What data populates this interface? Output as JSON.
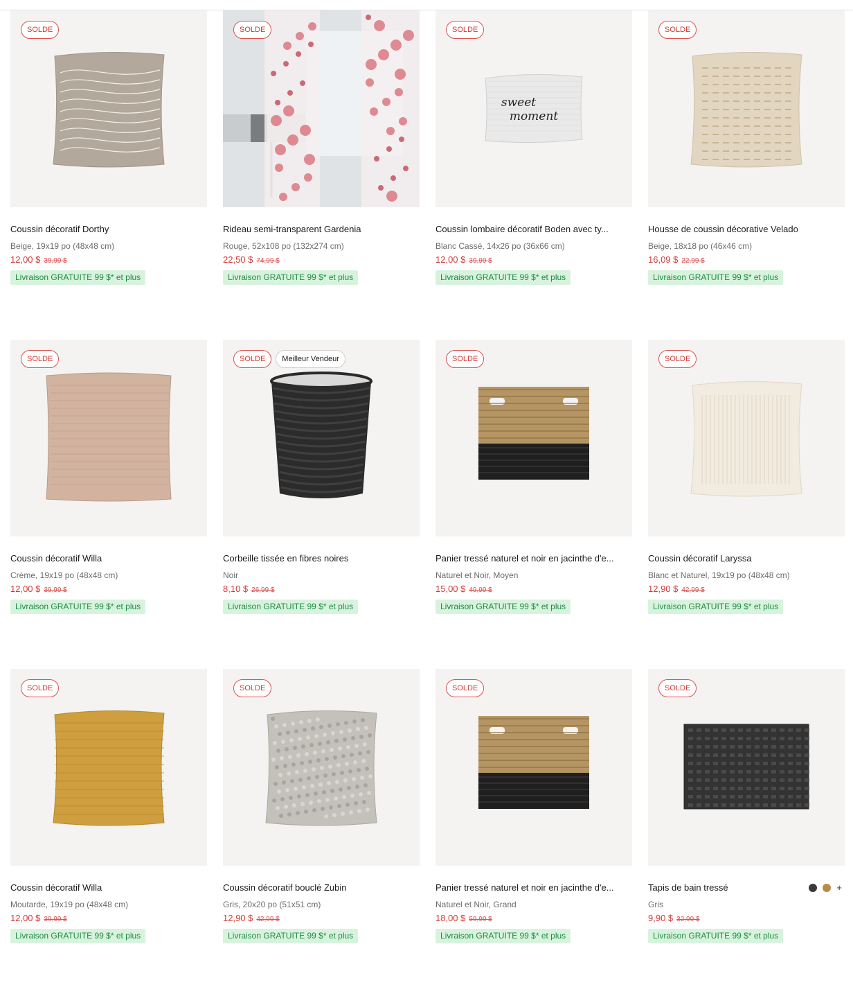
{
  "colors": {
    "sale": "#d33b35",
    "shipping_bg": "#d8f3dd",
    "shipping_text": "#1f8b44",
    "card_bg": "#f4f3f2"
  },
  "products": [
    {
      "badges": [
        "SOLDE"
      ],
      "name": "Coussin décoratif Dorthy",
      "variant": "Beige, 19x19 po (48x48 cm)",
      "price": "12,00 $",
      "was": "39,99 $",
      "shipping": "Livraison GRATUITE 99 $* et plus",
      "image": "pillow-beige-wave"
    },
    {
      "badges": [
        "SOLDE"
      ],
      "name": "Rideau semi-transparent Gardenia",
      "variant": "Rouge, 52x108 po (132x274 cm)",
      "price": "22,50 $",
      "was": "74,99 $",
      "shipping": "Livraison GRATUITE 99 $* et plus",
      "image": "curtain-red-floral"
    },
    {
      "badges": [
        "SOLDE"
      ],
      "name": "Coussin lombaire décoratif Boden avec ty...",
      "variant": "Blanc Cassé, 14x26 po (36x66 cm)",
      "price": "12,00 $",
      "was": "39,99 $",
      "shipping": "Livraison GRATUITE 99 $* et plus",
      "image": "lumbar-pillow-sweet-moment",
      "pillow_text": [
        "sweet",
        "moment"
      ]
    },
    {
      "badges": [
        "SOLDE"
      ],
      "name": "Housse de coussin décorative Velado",
      "variant": "Beige, 18x18 po (46x46 cm)",
      "price": "16,09 $",
      "was": "22,99 $",
      "shipping": "Livraison GRATUITE 99 $* et plus",
      "image": "pillow-beige-dashes"
    },
    {
      "badges": [
        "SOLDE"
      ],
      "name": "Coussin décoratif Willa",
      "variant": "Crème, 19x19 po (48x48 cm)",
      "price": "12,00 $",
      "was": "39,99 $",
      "shipping": "Livraison GRATUITE 99 $* et plus",
      "image": "pillow-taupe"
    },
    {
      "badges": [
        "SOLDE",
        "Meilleur Vendeur"
      ],
      "name": "Corbeille tissée en fibres noires",
      "variant": "Noir",
      "price": "8,10 $",
      "was": "26,99 $",
      "shipping": "Livraison GRATUITE 99 $* et plus",
      "image": "black-woven-basket"
    },
    {
      "badges": [
        "SOLDE"
      ],
      "name": "Panier tressé naturel et noir en jacinthe d'e...",
      "variant": "Naturel et Noir, Moyen",
      "price": "15,00 $",
      "was": "49,99 $",
      "shipping": "Livraison GRATUITE 99 $* et plus",
      "image": "seagrass-basket"
    },
    {
      "badges": [
        "SOLDE"
      ],
      "name": "Coussin décoratif Laryssa",
      "variant": "Blanc et Naturel, 19x19 po (48x48 cm)",
      "price": "12,90 $",
      "was": "42,99 $",
      "shipping": "Livraison GRATUITE 99 $* et plus",
      "image": "pillow-cream-stripe"
    },
    {
      "badges": [
        "SOLDE"
      ],
      "name": "Coussin décoratif Willa",
      "variant": "Moutarde, 19x19 po (48x48 cm)",
      "price": "12,00 $",
      "was": "39,99 $",
      "shipping": "Livraison GRATUITE 99 $* et plus",
      "image": "pillow-mustard"
    },
    {
      "badges": [
        "SOLDE"
      ],
      "name": "Coussin décoratif bouclé Zubin",
      "variant": "Gris, 20x20 po (51x51 cm)",
      "price": "12,90 $",
      "was": "42,99 $",
      "shipping": "Livraison GRATUITE 99 $* et plus",
      "image": "pillow-grey-boucle"
    },
    {
      "badges": [
        "SOLDE"
      ],
      "name": "Panier tressé naturel et noir en jacinthe d'e...",
      "variant": "Naturel et Noir, Grand",
      "price": "18,00 $",
      "was": "59,99 $",
      "shipping": "Livraison GRATUITE 99 $* et plus",
      "image": "seagrass-basket"
    },
    {
      "badges": [
        "SOLDE"
      ],
      "name": "Tapis de bain tressé",
      "variant": "Gris",
      "price": "9,90 $",
      "was": "32,99 $",
      "shipping": "Livraison GRATUITE 99 $* et plus",
      "image": "bath-mat-charcoal",
      "swatches": [
        "#3a3a3a",
        "#b98a4a"
      ],
      "more_swatches": "+"
    }
  ]
}
